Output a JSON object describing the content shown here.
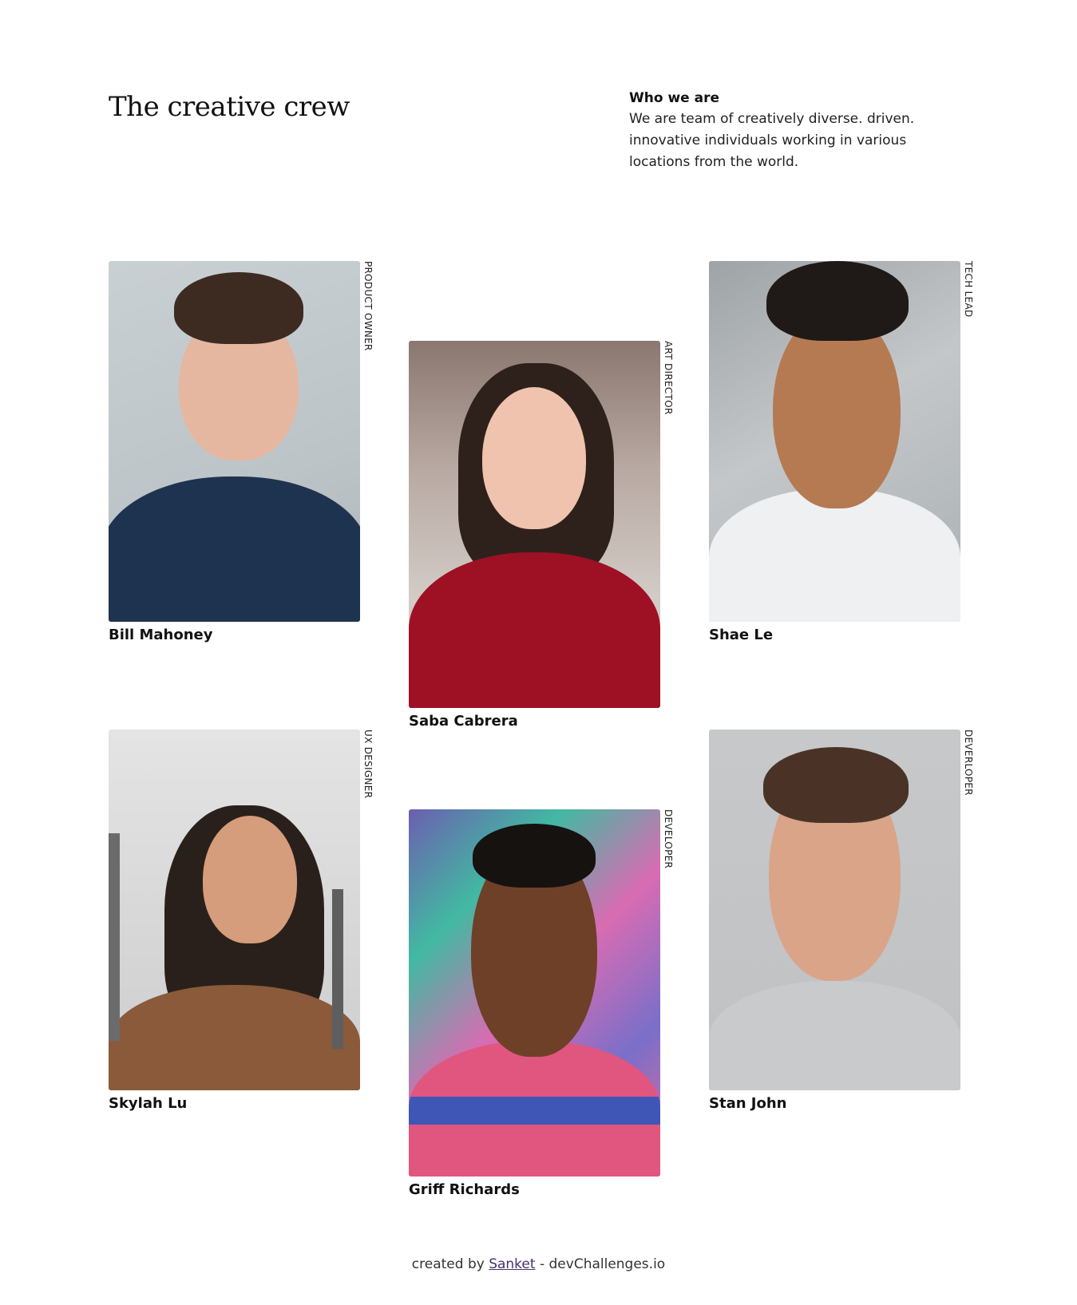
{
  "header": {
    "title": "The creative crew",
    "intro_heading": "Who we are",
    "intro_text": "We are team of creatively diverse. driven. innovative individuals working in various locations from the world."
  },
  "members": [
    {
      "name": "Bill Mahoney",
      "role": "PRODUCT OWNER"
    },
    {
      "name": "Saba Cabrera",
      "role": "ART DIRECTOR"
    },
    {
      "name": "Shae Le",
      "role": "TECH LEAD"
    },
    {
      "name": "Skylah Lu",
      "role": "UX DESIGNER"
    },
    {
      "name": "Griff Richards",
      "role": "DEVELOPER"
    },
    {
      "name": "Stan John",
      "role": "DEVERLOPER"
    }
  ],
  "footer": {
    "prefix": "created by",
    "author": "Sanket",
    "suffix": "- devChallenges.io"
  }
}
